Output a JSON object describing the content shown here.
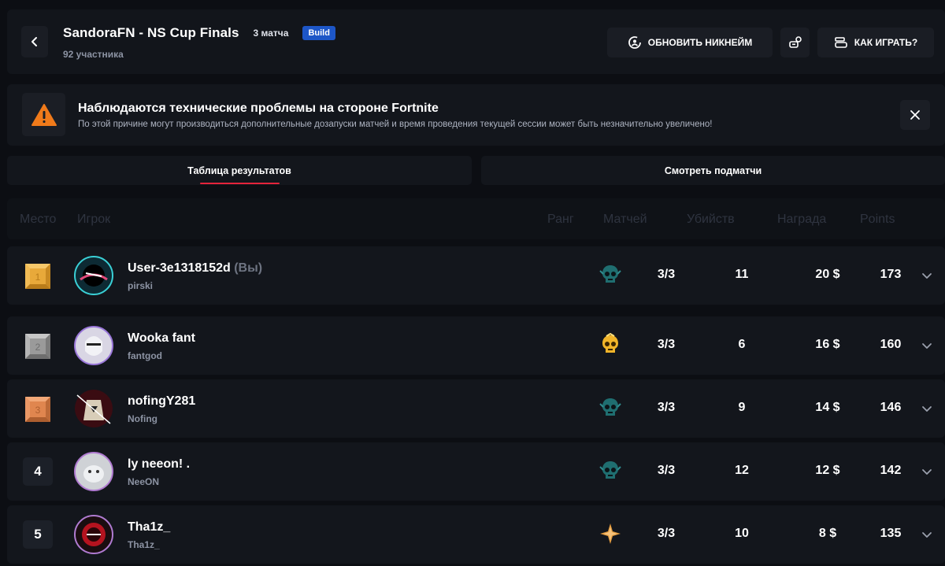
{
  "header": {
    "title": "SandoraFN - NS Cup Finals",
    "matches": "3 матча",
    "badge": "Build",
    "participants": "92 участника",
    "update_nick_label": "ОБНОВИТЬ НИКНЕЙМ",
    "how_to_play_label": "КАК ИГРАТЬ?"
  },
  "notice": {
    "title": "Наблюдаются технические проблемы на стороне Fortnite",
    "text": "По этой причине могут производиться дополнительные дозапуски матчей и время проведения текущей сессии может быть незначительно увеличено!"
  },
  "tabs": {
    "results": "Таблица результатов",
    "submatches": "Смотреть подматчи"
  },
  "columns": {
    "place": "Место",
    "player": "Игрок",
    "rank": "Ранг",
    "matches": "Матчей",
    "kills": "Убийств",
    "reward": "Награда",
    "points": "Points"
  },
  "rows": [
    {
      "place": "1",
      "name": "User-3e1318152d",
      "you": "(Вы)",
      "sub": "pirski",
      "matches": "3/3",
      "kills": "11",
      "reward": "20 $",
      "points": "173",
      "rank_icon": "skull-icon"
    },
    {
      "place": "2",
      "name": "Wooka fant",
      "you": "",
      "sub": "fantgod",
      "matches": "3/3",
      "kills": "6",
      "reward": "16 $",
      "points": "160",
      "rank_icon": "gold-skull-icon"
    },
    {
      "place": "3",
      "name": "nofingY281",
      "you": "",
      "sub": "Nofing",
      "matches": "3/3",
      "kills": "9",
      "reward": "14 $",
      "points": "146",
      "rank_icon": "skull-icon"
    },
    {
      "place": "4",
      "name": "ly neeon! .",
      "you": "",
      "sub": "NeeON",
      "matches": "3/3",
      "kills": "12",
      "reward": "12 $",
      "points": "142",
      "rank_icon": "skull-icon"
    },
    {
      "place": "5",
      "name": "Tha1z_",
      "you": "",
      "sub": "Tha1z_",
      "matches": "3/3",
      "kills": "10",
      "reward": "8 $",
      "points": "135",
      "rank_icon": "star-icon"
    }
  ],
  "colors": {
    "accent": "#e5243b",
    "badge": "#1d56c7",
    "gold": "#e8a93a",
    "silver": "#9a9a9a",
    "bronze": "#e0864f",
    "warning": "#f07a1a"
  }
}
